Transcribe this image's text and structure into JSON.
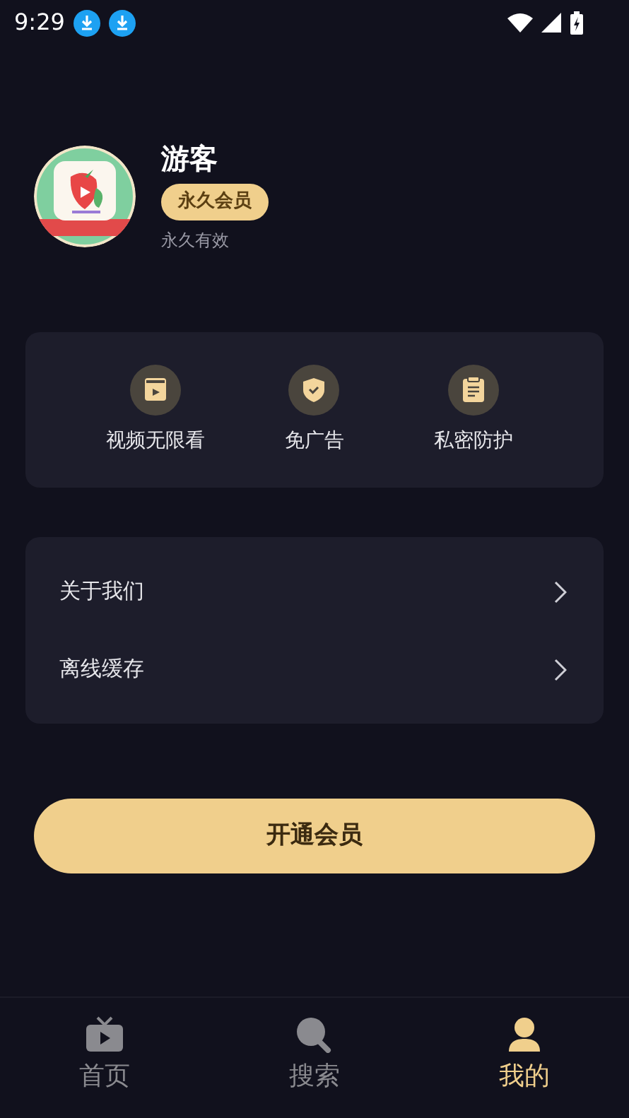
{
  "status_bar": {
    "time": "9:29"
  },
  "profile": {
    "name": "游客",
    "badge": "永久会员",
    "validity": "永久有效"
  },
  "benefits": [
    {
      "kind": "video",
      "label": "视频无限看"
    },
    {
      "kind": "shield",
      "label": "免广告"
    },
    {
      "kind": "clipboard",
      "label": "私密防护"
    }
  ],
  "menu": [
    {
      "label": "关于我们"
    },
    {
      "label": "离线缓存"
    }
  ],
  "action_button": "开通会员",
  "tabs": [
    {
      "kind": "tv",
      "label": "首页",
      "selected": false
    },
    {
      "kind": "search",
      "label": "搜索",
      "selected": false
    },
    {
      "kind": "person",
      "label": "我的",
      "selected": true
    }
  ]
}
